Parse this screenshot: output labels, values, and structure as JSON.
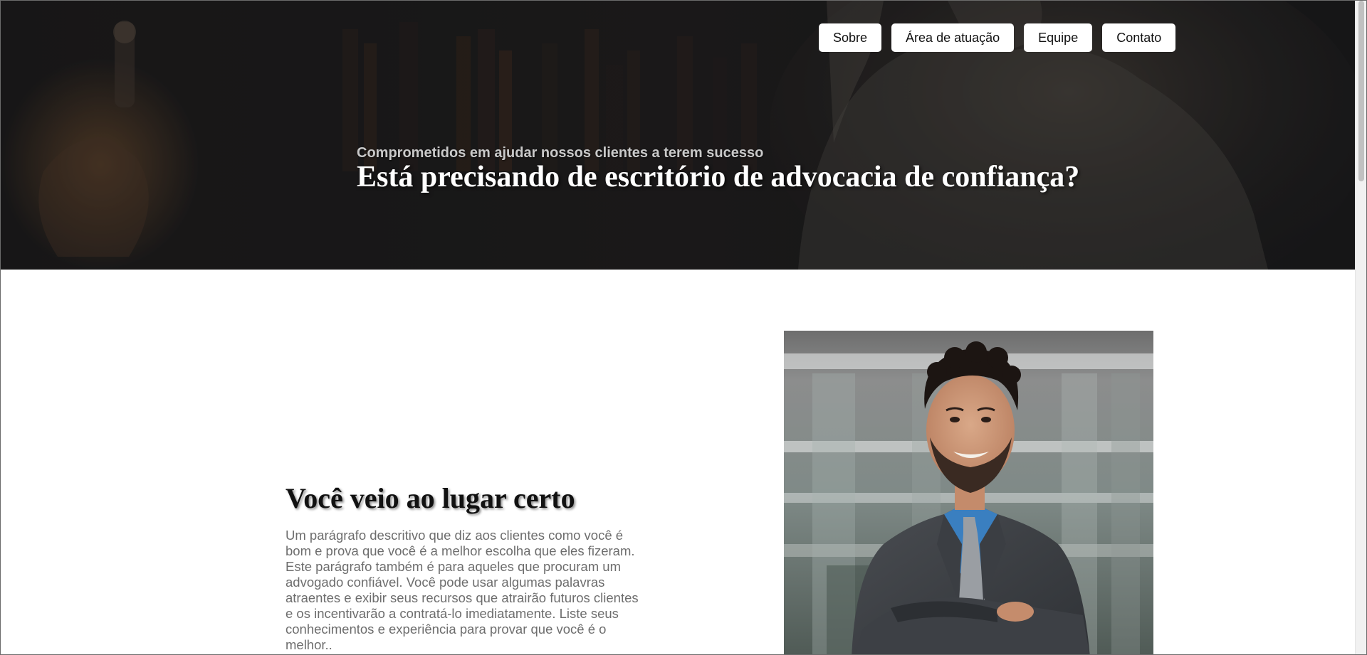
{
  "nav": {
    "items": [
      {
        "label": "Sobre"
      },
      {
        "label": "Área de atuação"
      },
      {
        "label": "Equipe"
      },
      {
        "label": "Contato"
      }
    ]
  },
  "hero": {
    "subtitle": "Comprometidos em ajudar nossos clientes a terem sucesso",
    "title": "Está precisando de escritório de advocacia de confiança?"
  },
  "about": {
    "title": "Você veio ao lugar certo",
    "text": "Um parágrafo descritivo que diz aos clientes como você é bom e prova que você é a melhor escolha que eles fizeram. Este parágrafo também é para aqueles que procuram um advogado confiável. Você pode usar algumas palavras atraentes e exibir seus recursos que atrairão futuros clientes e os incentivarão a contratá-lo imediatamente. Liste seus conhecimentos e experiência para provar que você é o melhor.."
  },
  "colors": {
    "hero_bg": "#1b1b1c",
    "nav_button_bg": "#ffffff",
    "hero_subtitle": "#c9c9c9",
    "body_text": "#6d6d6d"
  }
}
